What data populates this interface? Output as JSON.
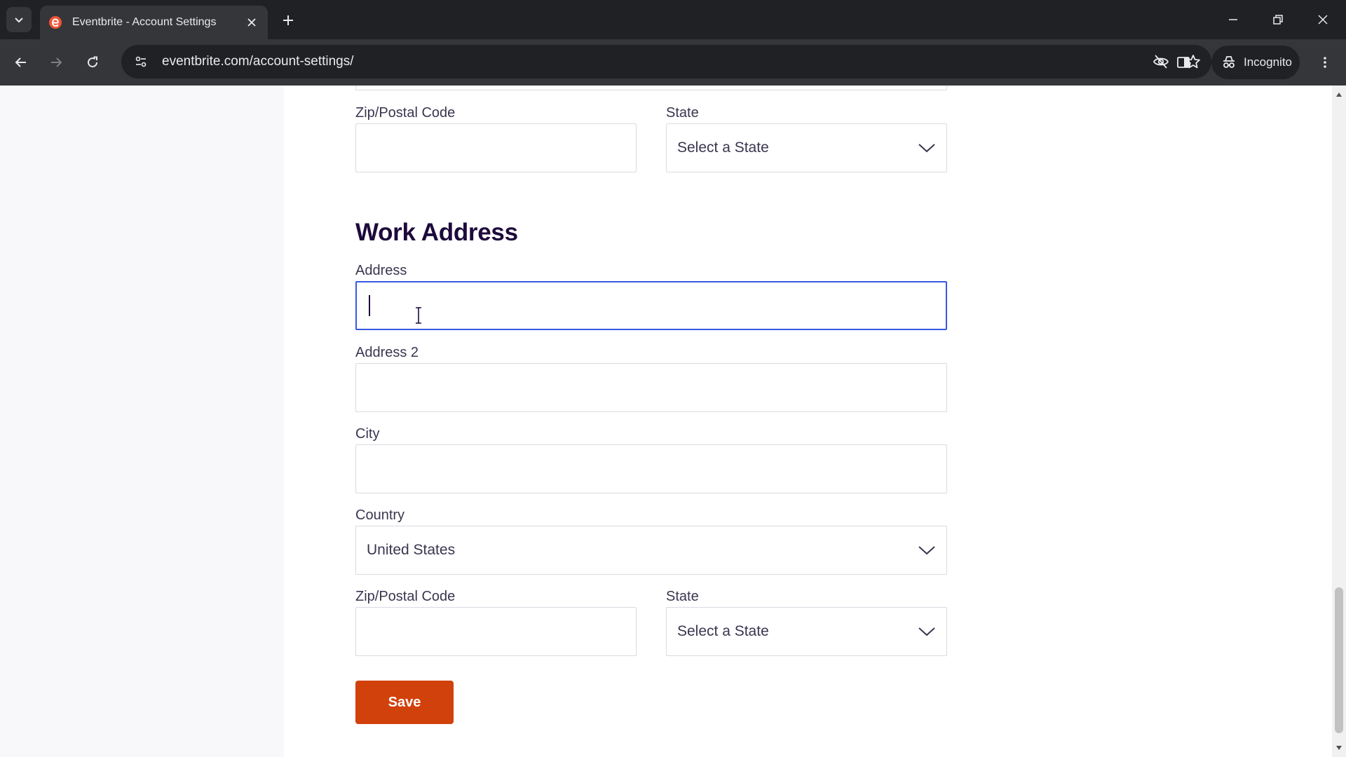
{
  "browser": {
    "tab_title": "Eventbrite - Account Settings",
    "url": "eventbrite.com/account-settings/",
    "incognito_label": "Incognito",
    "accent": "#f05537"
  },
  "form_top": {
    "zip_label": "Zip/Postal Code",
    "zip_value": "",
    "state_label": "State",
    "state_value": "Select a State"
  },
  "work_address": {
    "title": "Work Address",
    "address_label": "Address",
    "address_value": "",
    "address2_label": "Address 2",
    "address2_value": "",
    "city_label": "City",
    "city_value": "",
    "country_label": "Country",
    "country_value": "United States",
    "zip_label": "Zip/Postal Code",
    "zip_value": "",
    "state_label": "State",
    "state_value": "Select a State"
  },
  "actions": {
    "save_label": "Save",
    "save_color": "#d1410c"
  },
  "colors": {
    "focus_border": "#3659e3",
    "heading": "#1e0a3c",
    "label": "#39364f"
  }
}
